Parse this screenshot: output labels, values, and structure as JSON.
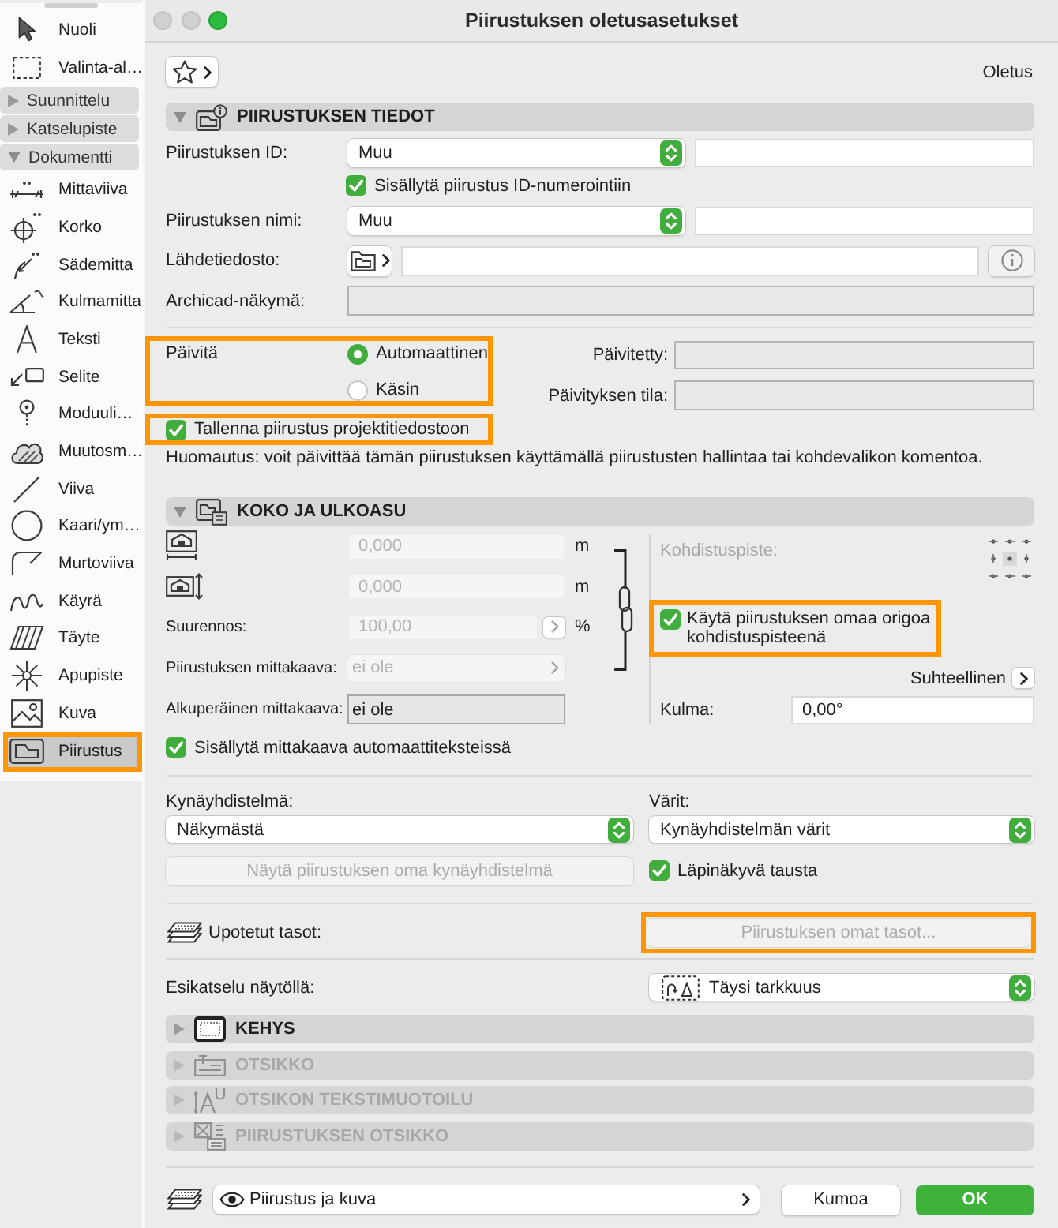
{
  "sidebar": {
    "items": [
      {
        "kind": "tool",
        "label": "Nuoli",
        "selected": false,
        "highlighted": false
      },
      {
        "kind": "tool",
        "label": "Valinta-al…",
        "selected": false,
        "highlighted": false
      },
      {
        "kind": "group",
        "label": "Suunnittelu",
        "expanded": false
      },
      {
        "kind": "group",
        "label": "Katselupiste",
        "expanded": false
      },
      {
        "kind": "group",
        "label": "Dokumentti",
        "expanded": true,
        "children": [
          {
            "kind": "tool",
            "label": "Mittaviiva",
            "selected": false,
            "highlighted": false
          },
          {
            "kind": "tool",
            "label": "Korko",
            "selected": false,
            "highlighted": false
          },
          {
            "kind": "tool",
            "label": "Sädemitta",
            "selected": false,
            "highlighted": false
          },
          {
            "kind": "tool",
            "label": "Kulmamitta",
            "selected": false,
            "highlighted": false
          },
          {
            "kind": "tool",
            "label": "Teksti",
            "selected": false,
            "highlighted": false
          },
          {
            "kind": "tool",
            "label": "Selite",
            "selected": false,
            "highlighted": false
          },
          {
            "kind": "tool",
            "label": "Moduuli…",
            "selected": false,
            "highlighted": false
          },
          {
            "kind": "tool",
            "label": "Muutosm…",
            "selected": false,
            "highlighted": false
          },
          {
            "kind": "tool",
            "label": "Viiva",
            "selected": false,
            "highlighted": false
          },
          {
            "kind": "tool",
            "label": "Kaari/ym…",
            "selected": false,
            "highlighted": false
          },
          {
            "kind": "tool",
            "label": "Murtoviiva",
            "selected": false,
            "highlighted": false
          },
          {
            "kind": "tool",
            "label": "Käyrä",
            "selected": false,
            "highlighted": false
          },
          {
            "kind": "tool",
            "label": "Täyte",
            "selected": false,
            "highlighted": false
          },
          {
            "kind": "tool",
            "label": "Apupiste",
            "selected": false,
            "highlighted": false
          },
          {
            "kind": "tool",
            "label": "Kuva",
            "selected": false,
            "highlighted": false
          },
          {
            "kind": "tool",
            "label": "Piirustus",
            "selected": true,
            "highlighted": true
          }
        ]
      }
    ]
  },
  "window": {
    "title": "Piirustuksen oletusasetukset"
  },
  "favorites": {
    "preset": "Oletus"
  },
  "drawing_info": {
    "title": "PIIRUSTUKSEN TIEDOT",
    "expanded": true,
    "id": {
      "label": "Piirustuksen ID:",
      "value": "Muu"
    },
    "include_in_numbering": {
      "label": "Sisällytä piirustus ID-numerointiin",
      "checked": true
    },
    "name": {
      "label": "Piirustuksen nimi:",
      "value": "Muu"
    },
    "source_file": {
      "label": "Lähdetiedosto:"
    },
    "archicad_view": {
      "label": "Archicad-näkymä:"
    },
    "update": {
      "label": "Päivitä",
      "highlighted": true,
      "options": [
        {
          "label": "Automaattinen",
          "selected": true
        },
        {
          "label": "Käsin",
          "selected": false
        }
      ]
    },
    "updated": {
      "label": "Päivitetty:"
    },
    "update_status": {
      "label": "Päivityksen tila:"
    },
    "store_in_project": {
      "label": "Tallenna piirustus projektitiedostoon",
      "checked": true,
      "highlighted": true
    },
    "note": "Huomautus: voit päivittää tämän piirustuksen käyttämällä piirustusten hallintaa tai kohdevalikon komentoa."
  },
  "size_and_appearance": {
    "title": "KOKO JA ULKOASU",
    "expanded": true,
    "width": {
      "value": "0,000",
      "unit": "m",
      "disabled": true
    },
    "height": {
      "value": "0,000",
      "unit": "m",
      "disabled": true
    },
    "magnification": {
      "label": "Suurennos:",
      "value": "100,00",
      "unit": "%",
      "disabled": true
    },
    "drawing_scale": {
      "label": "Piirustuksen mittakaava:",
      "value": "ei ole",
      "disabled": true
    },
    "original_scale": {
      "label": "Alkuperäinen mittakaava:",
      "value": "ei ole"
    },
    "anchor_point": {
      "label": "Kohdistuspiste:",
      "disabled": true
    },
    "use_own_origin": {
      "label": "Käytä piirustuksen omaa origoa kohdistuspisteenä",
      "checked": true,
      "highlighted": true
    },
    "relative": {
      "label": "Suhteellinen"
    },
    "angle": {
      "label": "Kulma:",
      "value": "0,00°"
    },
    "include_scale_in_autotext": {
      "label": "Sisällytä mittakaava automaattiteksteissä",
      "checked": true
    },
    "pen_set": {
      "label": "Kynäyhdistelmä:",
      "value": "Näkymästä"
    },
    "colors": {
      "label": "Värit:",
      "value": "Kynäyhdistelmän värit"
    },
    "own_pen_set_button": {
      "label": "Näytä piirustuksen oma kynäyhdistelmä",
      "disabled": true
    },
    "transparent_background": {
      "label": "Läpinäkyvä tausta",
      "checked": true
    },
    "embedded_layers": {
      "label": "Upotetut tasot:",
      "button": "Piirustuksen omat tasot...",
      "disabled": true,
      "highlighted": true
    },
    "preview": {
      "label": "Esikatselu näytöllä:",
      "value": "Täysi tarkkuus"
    }
  },
  "more_sections": [
    {
      "title": "KEHYS",
      "expanded": false,
      "disabled": false
    },
    {
      "title": "OTSIKKO",
      "expanded": false,
      "disabled": true
    },
    {
      "title": "OTSIKON TEKSTIMUOTOILU",
      "expanded": false,
      "disabled": true
    },
    {
      "title": "PIIRUSTUKSEN OTSIKKO",
      "expanded": false,
      "disabled": true
    }
  ],
  "footer": {
    "view": "Piirustus ja kuva",
    "buttons": [
      {
        "label": "Kumoa",
        "kind": "secondary"
      },
      {
        "label": "OK",
        "kind": "primary"
      }
    ]
  }
}
